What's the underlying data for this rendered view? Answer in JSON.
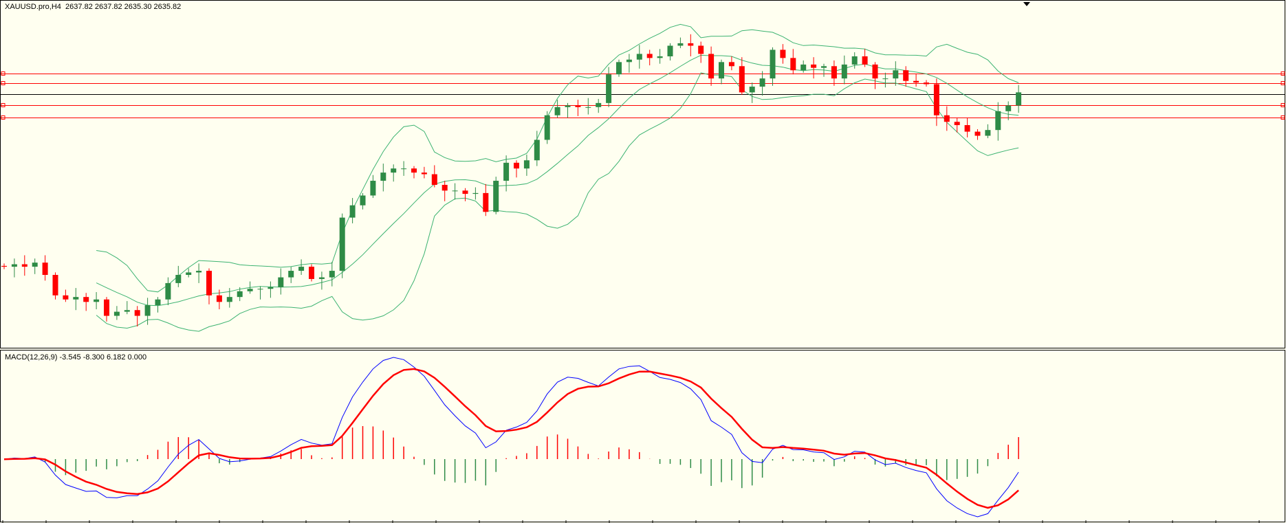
{
  "header": {
    "symbol_label": "XAUUSD.pro,H4",
    "ohlc": "2637.82 2637.82 2635.30 2635.82"
  },
  "macd": {
    "label": "MACD(12,26,9)",
    "values": "-3.545 -8.300 6.182 0.000"
  },
  "colors": {
    "background": "#fffff0",
    "bull": "#2e8b46",
    "bear": "#ff0000",
    "bands": "#3cb371",
    "macd_line": "#0000ff",
    "signal_line": "#ff0000",
    "hline": "#ff0000",
    "price_line": "#000000"
  },
  "chart_data": {
    "type": "candlestick",
    "ylim": [
      2478,
      2690
    ],
    "closes": [
      2527.5,
      2529,
      2527.5,
      2530,
      2522.5,
      2510,
      2507.5,
      2509,
      2506,
      2507.5,
      2497.5,
      2500,
      2501,
      2497.5,
      2504,
      2507.5,
      2517.5,
      2522.5,
      2524,
      2525,
      2510,
      2506,
      2509,
      2512.5,
      2514,
      2514,
      2515,
      2521,
      2525,
      2527.5,
      2520,
      2521,
      2525,
      2557.5,
      2565,
      2571,
      2580,
      2585,
      2587.5,
      2587.5,
      2585,
      2584,
      2577.5,
      2574,
      2574,
      2572,
      2572.5,
      2561,
      2580,
      2591,
      2587.5,
      2592.5,
      2605,
      2620,
      2625,
      2626,
      2625,
      2625,
      2627.5,
      2645,
      2652.5,
      2654,
      2657.5,
      2655,
      2656,
      2662.5,
      2664,
      2662.5,
      2657.5,
      2642.5,
      2652.5,
      2650,
      2634,
      2637.5,
      2642.5,
      2660,
      2655,
      2647.5,
      2651,
      2649,
      2650,
      2642.5,
      2651,
      2656,
      2651,
      2642.5,
      2642.5,
      2647.5,
      2641,
      2640,
      2639,
      2620,
      2616,
      2614,
      2610,
      2607.5,
      2611,
      2622.5,
      2626,
      2634
    ],
    "first_open": 2528,
    "horizontal_lines": [
      2645.5,
      2639.5,
      2626,
      2618.5
    ],
    "price_line": 2633
  }
}
